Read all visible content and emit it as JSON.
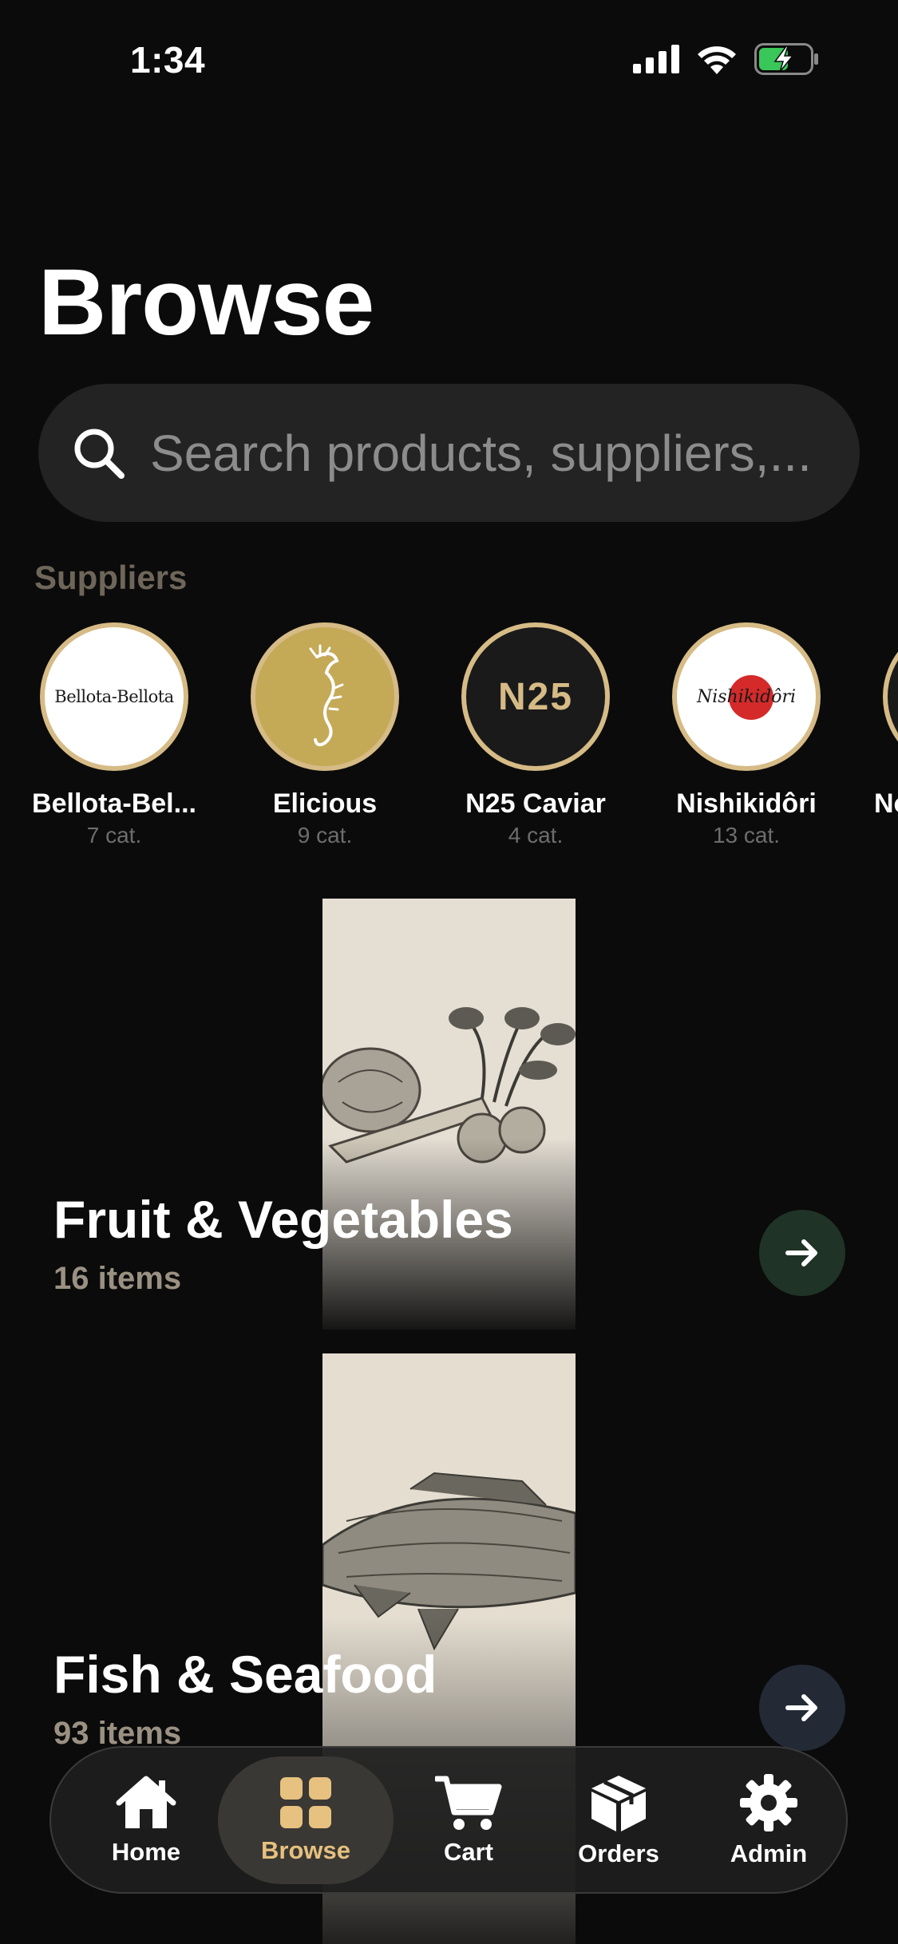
{
  "status_bar": {
    "time": "1:34"
  },
  "page": {
    "title": "Browse"
  },
  "search": {
    "placeholder": "Search products, suppliers,..."
  },
  "suppliers": {
    "label": "Suppliers",
    "items": [
      {
        "name": "Bellota-Bel...",
        "count": "7 cat.",
        "logo_text": "Bellota-Bellota"
      },
      {
        "name": "Elicious",
        "count": "9 cat."
      },
      {
        "name": "N25 Caviar",
        "count": "4 cat.",
        "logo_text": "N25"
      },
      {
        "name": "Nishikidôri",
        "count": "13 cat.",
        "logo_text": "Nishikidôri"
      },
      {
        "name": "No",
        "count": ""
      }
    ]
  },
  "categories": [
    {
      "title": "Fruit & Vegetables",
      "count": "16 items",
      "arrow_color": "#1f3326"
    },
    {
      "title": "Fish & Seafood",
      "count": "93 items",
      "arrow_color": "#232a36"
    }
  ],
  "tabs": [
    {
      "label": "Home",
      "icon": "home-icon"
    },
    {
      "label": "Browse",
      "icon": "grid-icon",
      "active": true
    },
    {
      "label": "Cart",
      "icon": "cart-icon"
    },
    {
      "label": "Orders",
      "icon": "box-icon"
    },
    {
      "label": "Admin",
      "icon": "gear-icon"
    }
  ],
  "colors": {
    "background": "#0b0b0b",
    "accent_gold": "#d6bb86",
    "active_tab": "#e6c17f"
  }
}
